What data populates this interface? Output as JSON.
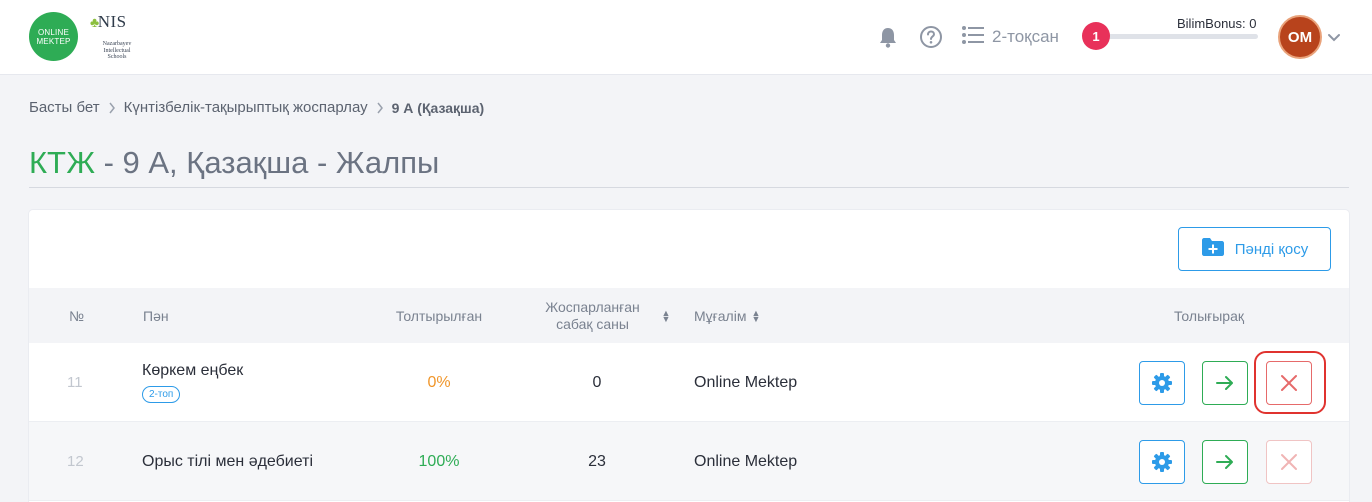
{
  "header": {
    "logo_online_line1": "ONLINE",
    "logo_online_line2": "MEKTEP",
    "logo_nis_mark": "NIS",
    "logo_nis_sub": "Nazarbayev Intellectual Schools",
    "quarter_label": "2-тоқсан",
    "bonus_label": "BilimBonus: 0",
    "bonus_progress": 0,
    "notification_count": "1",
    "avatar_initials": "OM",
    "icons": [
      "bell-icon",
      "help-icon",
      "list-icon",
      "chevron-down-icon"
    ]
  },
  "breadcrumb": {
    "items": [
      "Басты бет",
      "Күнтізбелік-тақырыптық жоспарлау",
      "9 А (Қазақша)"
    ]
  },
  "page": {
    "title_accent": "КТЖ",
    "title_rest": " - 9 А, Қазақша - Жалпы"
  },
  "toolbar": {
    "add_subject_label": "Пәнді қосу"
  },
  "table": {
    "columns": {
      "num": "№",
      "subject": "Пән",
      "filled": "Толтырылған",
      "planned": "Жоспарланған сабақ саны",
      "teacher": "Мұғалім",
      "more": "Толығырақ"
    },
    "rows": [
      {
        "num": "11",
        "subject": "Көркем еңбек",
        "tag": "2-топ",
        "filled": "0%",
        "planned": "0",
        "teacher": "Online Mektep"
      },
      {
        "num": "12",
        "subject": "Орыс тілі мен әдебиеті",
        "tag": "",
        "filled": "100%",
        "planned": "23",
        "teacher": "Online Mektep"
      }
    ]
  },
  "colors": {
    "accent_green": "#2eac55",
    "accent_blue": "#2d9be8",
    "danger_red": "#e66a6a",
    "badge_red": "#e8315a",
    "highlight_red": "#e0332f"
  }
}
